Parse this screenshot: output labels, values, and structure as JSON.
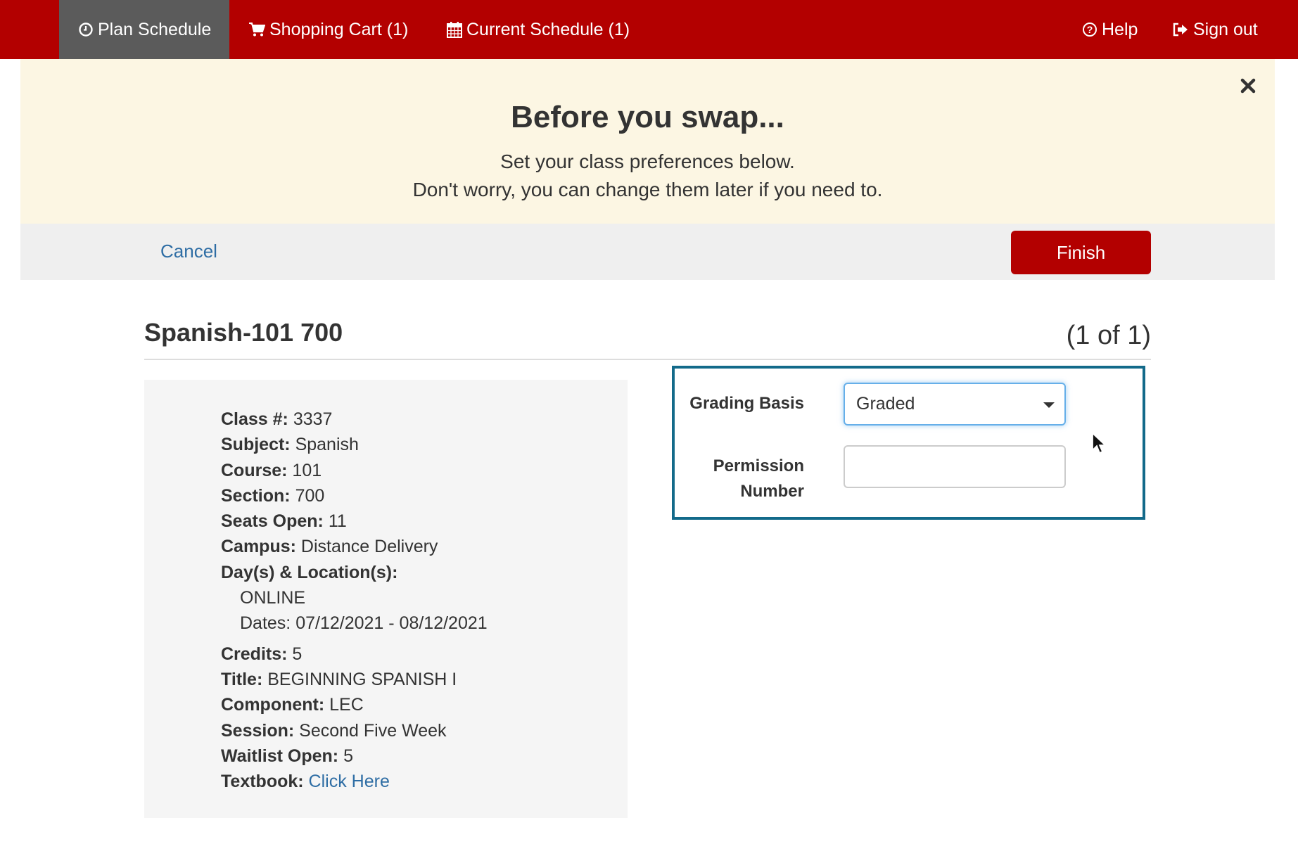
{
  "nav": {
    "plan_schedule": "Plan Schedule",
    "shopping_cart": "Shopping Cart (1)",
    "current_schedule": "Current Schedule (1)",
    "help": "Help",
    "sign_out": "Sign out",
    "icons": {
      "plan_schedule": "clock-icon",
      "shopping_cart": "cart-icon",
      "current_schedule": "calendar-icon",
      "help": "question-circle-icon",
      "sign_out": "sign-out-icon"
    },
    "active": "plan_schedule"
  },
  "banner": {
    "title": "Before you swap...",
    "line1": "Set your class preferences below.",
    "line2": "Don't worry, you can change them later if you need to.",
    "close_icon": "close-icon"
  },
  "actions": {
    "cancel": "Cancel",
    "finish": "Finish"
  },
  "class": {
    "title": "Spanish-101 700",
    "count": "(1 of 1)",
    "details": {
      "class_no": {
        "label": "Class #:",
        "value": "3337"
      },
      "subject": {
        "label": "Subject:",
        "value": "Spanish"
      },
      "course": {
        "label": "Course:",
        "value": "101"
      },
      "section": {
        "label": "Section:",
        "value": "700"
      },
      "seats_open": {
        "label": "Seats Open:",
        "value": "11"
      },
      "campus": {
        "label": "Campus:",
        "value": "Distance Delivery"
      },
      "days_locations": {
        "label": "Day(s) & Location(s):"
      },
      "location": "ONLINE",
      "dates": "Dates: 07/12/2021 - 08/12/2021",
      "credits": {
        "label": "Credits:",
        "value": "5"
      },
      "title": {
        "label": "Title:",
        "value": "BEGINNING SPANISH I"
      },
      "component": {
        "label": "Component:",
        "value": "LEC"
      },
      "session": {
        "label": "Session:",
        "value": "Second Five Week"
      },
      "waitlist_open": {
        "label": "Waitlist Open:",
        "value": "5"
      },
      "textbook": {
        "label": "Textbook:",
        "link": "Click Here"
      }
    }
  },
  "form": {
    "grading_basis_label": "Grading Basis",
    "grading_basis_value": "Graded",
    "permission_label_1": "Permission",
    "permission_label_2": "Number",
    "permission_value": "",
    "permission_placeholder": ""
  },
  "colors": {
    "brand": "#b30000",
    "active_tab": "#5b5b5b",
    "banner_bg": "#fcf6e3",
    "link": "#2e6da4",
    "form_border": "#136a8a"
  }
}
